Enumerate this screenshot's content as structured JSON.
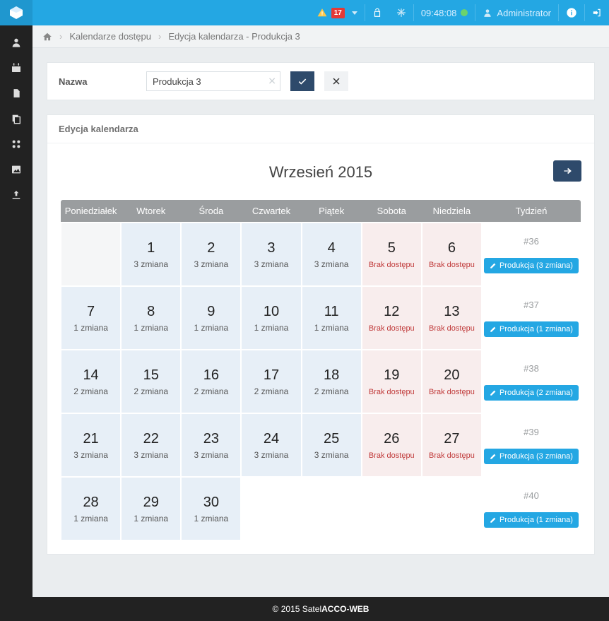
{
  "topbar": {
    "alert_count": "17",
    "time": "09:48:08",
    "user": "Administrator"
  },
  "breadcrumb": {
    "link1": "Kalendarze dostępu",
    "current": "Edycja kalendarza - Produkcja 3"
  },
  "form": {
    "name_label": "Nazwa",
    "name_value": "Produkcja 3"
  },
  "panel_title": "Edycja kalendarza",
  "month_title": "Wrzesień 2015",
  "headers": [
    "Poniedziałek",
    "Wtorek",
    "Środa",
    "Czwartek",
    "Piątek",
    "Sobota",
    "Niedziela",
    "Tydzień"
  ],
  "no_access": "Brak dostępu",
  "shifts": {
    "s1": "1 zmiana",
    "s2": "2 zmiana",
    "s3": "3 zmiana"
  },
  "weeks": {
    "w0": {
      "num": "#36",
      "btn": "Produkcja (3 zmiana)"
    },
    "w1": {
      "num": "#37",
      "btn": "Produkcja (1 zmiana)"
    },
    "w2": {
      "num": "#38",
      "btn": "Produkcja (2 zmiana)"
    },
    "w3": {
      "num": "#39",
      "btn": "Produkcja (3 zmiana)"
    },
    "w4": {
      "num": "#40",
      "btn": "Produkcja (1 zmiana)"
    }
  },
  "days": {
    "d1": "1",
    "d2": "2",
    "d3": "3",
    "d4": "4",
    "d5": "5",
    "d6": "6",
    "d7": "7",
    "d8": "8",
    "d9": "9",
    "d10": "10",
    "d11": "11",
    "d12": "12",
    "d13": "13",
    "d14": "14",
    "d15": "15",
    "d16": "16",
    "d17": "17",
    "d18": "18",
    "d19": "19",
    "d20": "20",
    "d21": "21",
    "d22": "22",
    "d23": "23",
    "d24": "24",
    "d25": "25",
    "d26": "26",
    "d27": "27",
    "d28": "28",
    "d29": "29",
    "d30": "30"
  },
  "footer": {
    "prefix": "© 2015 Satel ",
    "name": "ACCO-WEB"
  }
}
